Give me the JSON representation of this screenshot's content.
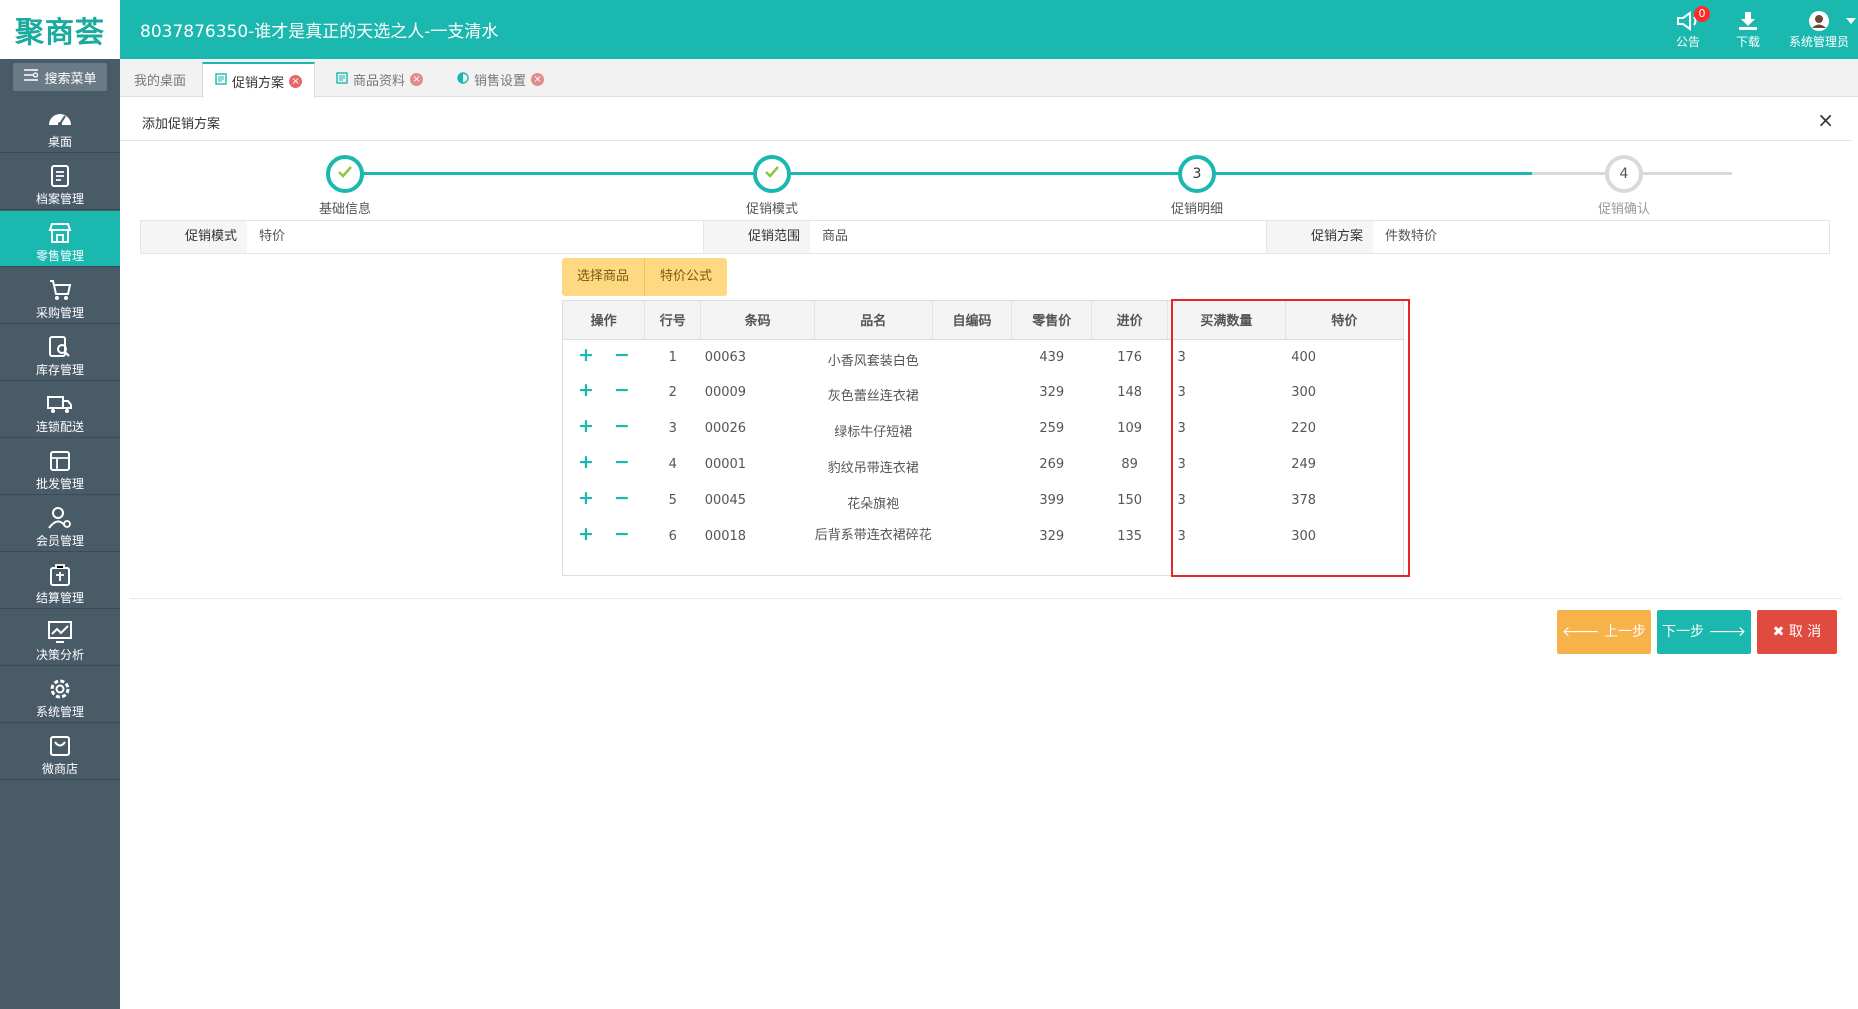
{
  "brand": {
    "logo_text": "聚商荟",
    "accent": "#1bb8b0"
  },
  "header": {
    "title": "8037876350-谁才是真正的天选之人-一支清水",
    "notice": {
      "label": "公告",
      "badge": "0",
      "icon": "speaker-icon"
    },
    "download": {
      "label": "下载",
      "icon": "download-icon"
    },
    "user": {
      "label": "系统管理员",
      "icon": "avatar-icon"
    }
  },
  "sidebar": {
    "search_label": "搜索菜单",
    "items": [
      {
        "label": "桌面",
        "icon": "dashboard-icon"
      },
      {
        "label": "档案管理",
        "icon": "archive-icon"
      },
      {
        "label": "零售管理",
        "icon": "store-icon",
        "active": true
      },
      {
        "label": "采购管理",
        "icon": "cart-icon"
      },
      {
        "label": "库存管理",
        "icon": "inventory-icon"
      },
      {
        "label": "连锁配送",
        "icon": "truck-icon"
      },
      {
        "label": "批发管理",
        "icon": "wholesale-icon"
      },
      {
        "label": "会员管理",
        "icon": "member-icon"
      },
      {
        "label": "结算管理",
        "icon": "settlement-icon"
      },
      {
        "label": "决策分析",
        "icon": "analysis-icon"
      },
      {
        "label": "系统管理",
        "icon": "settings-icon"
      },
      {
        "label": "微商店",
        "icon": "shop-bag-icon"
      }
    ]
  },
  "tabs": [
    {
      "label": "我的桌面"
    },
    {
      "label": "促销方案",
      "active": true
    },
    {
      "label": "商品资料"
    },
    {
      "label": "销售设置"
    }
  ],
  "panel": {
    "title": "添加促销方案",
    "close": "×"
  },
  "steps": [
    {
      "num": "1",
      "label": "基础信息",
      "done": true
    },
    {
      "num": "2",
      "label": "促销模式",
      "done": true
    },
    {
      "num": "3",
      "label": "促销明细",
      "current": true
    },
    {
      "num": "4",
      "label": "促销确认"
    }
  ],
  "form": {
    "mode_label": "促销模式",
    "mode_value": "特价",
    "scope_label": "促销范围",
    "scope_value": "商品",
    "plan_label": "促销方案",
    "plan_value": "件数特价"
  },
  "actions": {
    "select_goods": "选择商品",
    "price_formula": "特价公式"
  },
  "table": {
    "headers": [
      "操作",
      "行号",
      "条码",
      "品名",
      "自编码",
      "零售价",
      "进价",
      "买满数量",
      "特价"
    ],
    "rows": [
      {
        "no": "1",
        "code": "00063",
        "name": "小香风套装白色",
        "selfcode": "",
        "retail": "439",
        "cost": "176",
        "qty": "3",
        "special": "400"
      },
      {
        "no": "2",
        "code": "00009",
        "name": "灰色蕾丝连衣裙",
        "selfcode": "",
        "retail": "329",
        "cost": "148",
        "qty": "3",
        "special": "300"
      },
      {
        "no": "3",
        "code": "00026",
        "name": "绿标牛仔短裙",
        "selfcode": "",
        "retail": "259",
        "cost": "109",
        "qty": "3",
        "special": "220"
      },
      {
        "no": "4",
        "code": "00001",
        "name": "豹纹吊带连衣裙",
        "selfcode": "",
        "retail": "269",
        "cost": "89",
        "qty": "3",
        "special": "249"
      },
      {
        "no": "5",
        "code": "00045",
        "name": "花朵旗袍",
        "selfcode": "",
        "retail": "399",
        "cost": "150",
        "qty": "3",
        "special": "378"
      },
      {
        "no": "6",
        "code": "00018",
        "name": "后背系带连衣裙碎花",
        "selfcode": "",
        "retail": "329",
        "cost": "135",
        "qty": "3",
        "special": "300"
      }
    ]
  },
  "buttons": {
    "prev": "上一步",
    "next": "下一步",
    "cancel": "取 消",
    "prev_color": "#f7b24a",
    "next_color": "#1bb8b0",
    "cancel_color": "#e04a3f"
  }
}
